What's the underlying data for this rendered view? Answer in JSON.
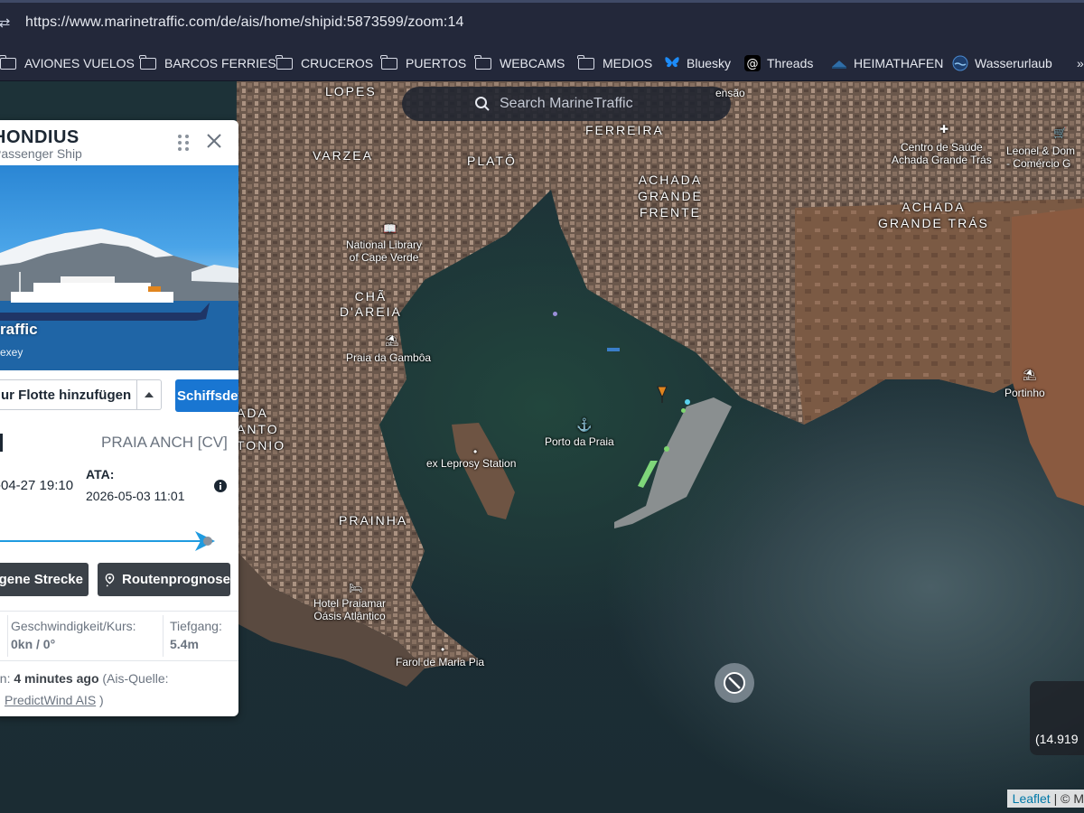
{
  "browser": {
    "url": "https://www.marinetraffic.com/de/ais/home/shipid:5873599/zoom:14",
    "bookmarks": [
      {
        "label": "AVIONES VUELOS",
        "icon": "folder-icon"
      },
      {
        "label": "BARCOS FERRIES",
        "icon": "folder-icon"
      },
      {
        "label": "CRUCEROS",
        "icon": "folder-icon"
      },
      {
        "label": "PUERTOS",
        "icon": "folder-icon"
      },
      {
        "label": "WEBCAMS",
        "icon": "folder-icon"
      },
      {
        "label": "MEDIOS",
        "icon": "folder-icon"
      },
      {
        "label": "Bluesky",
        "icon": "bluesky-icon"
      },
      {
        "label": "Threads",
        "icon": "threads-icon"
      },
      {
        "label": "HEIMATHAFEN",
        "icon": "heimathafen-icon"
      },
      {
        "label": "Wasserurlaub",
        "icon": "wasserurlaub-icon"
      }
    ],
    "overflow": "»"
  },
  "map": {
    "search_placeholder": "Search MarineTraffic",
    "labels": {
      "lopes": "LOPES",
      "ensao": "ensão",
      "ferreira": "FERREIRA",
      "varzea": "VARZEA",
      "plato": "PLATÔ",
      "achada_frente": "ACHADA\nGRANDE\nFRENTE",
      "centro_saude": "Centro de Saúde\nAchada Grande Trás",
      "leonel": "Leonel & Dom\n- Comércio G",
      "achada_tras": "ACHADA\nGRANDE TRÁS",
      "library": "National Library\nof Cape Verde",
      "cha_areia": "CHÃ\nD'AREIA",
      "praia_gamboa": "Praia da Gambôa",
      "portinho": "Portinho",
      "santo_antonio": "ADA\nANTO\nTONIO",
      "porto_praia": "Porto da Praia",
      "leprosy": "ex Leprosy Station",
      "prainha": "PRAINHA",
      "hotel": "Hotel Praiamar\nOásis Atlântico",
      "farol": "Farol de Maria Pia"
    },
    "coordinate": "(14.919",
    "attribution": {
      "leaflet": "Leaflet",
      "rest": " | © M"
    }
  },
  "vessel": {
    "name": "HONDIUS",
    "type": "Passenger Ship",
    "photo_watermark": "raffic",
    "photo_credit": "exey",
    "add_fleet": "ur Flotte hinzufügen",
    "details": "Schiffsdetails",
    "destination": "PRAIA ANCH [CV]",
    "atd": "-04-27 19:10",
    "ata_label": "ATA:",
    "ata": "2026-05-03 11:01",
    "progress": 1.0,
    "past_track": "agene Strecke",
    "route_forecast": "Routenprognose",
    "speed_label": "Geschwindigkeit/Kurs:",
    "speed_value": "0kn / 0°",
    "draught_label": "Tiefgang:",
    "draught_value": "5.4m",
    "received_prefix": "en: ",
    "received_ago": "4 minutes ago",
    "received_source_prefix": " (Ais-Quelle:",
    "source": "PredictWind AIS",
    "source_suffix": " )"
  },
  "colors": {
    "accent_blue": "#1976d2",
    "progress_blue": "#1f9be0",
    "dark_button": "#3b4148"
  }
}
